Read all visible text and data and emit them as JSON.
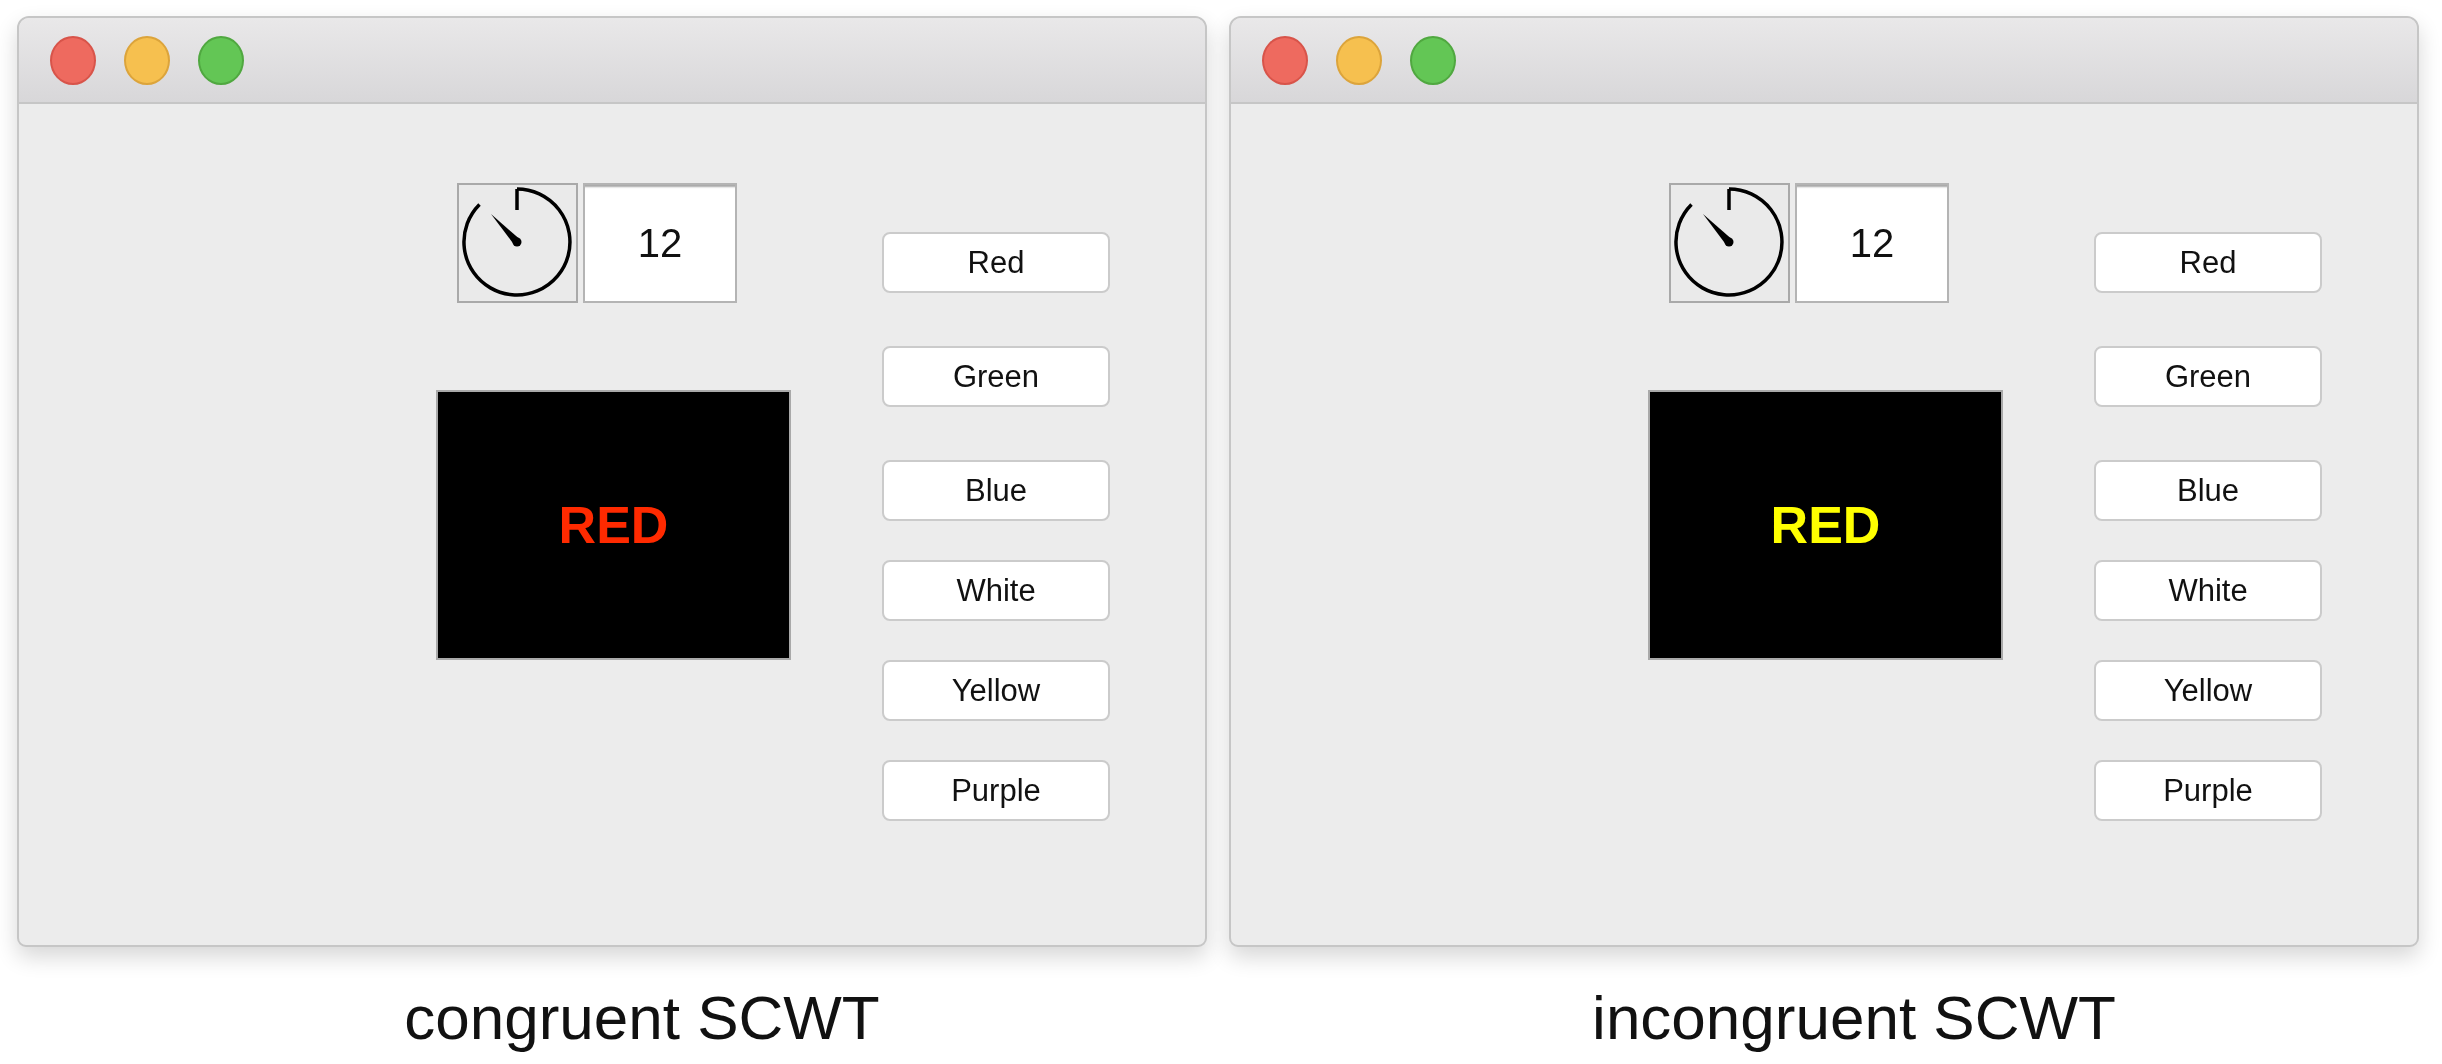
{
  "panels": [
    {
      "window": {
        "timer": {
          "value": "12"
        },
        "stimulus": {
          "word": "RED",
          "color": "#ff2a00"
        },
        "buttons": [
          "Red",
          "Green",
          "Blue",
          "White",
          "Yellow",
          "Purple"
        ]
      },
      "caption": "congruent SCWT"
    },
    {
      "window": {
        "timer": {
          "value": "12"
        },
        "stimulus": {
          "word": "RED",
          "color": "#ffff00"
        },
        "buttons": [
          "Red",
          "Green",
          "Blue",
          "White",
          "Yellow",
          "Purple"
        ]
      },
      "caption": "incongruent SCWT"
    }
  ]
}
